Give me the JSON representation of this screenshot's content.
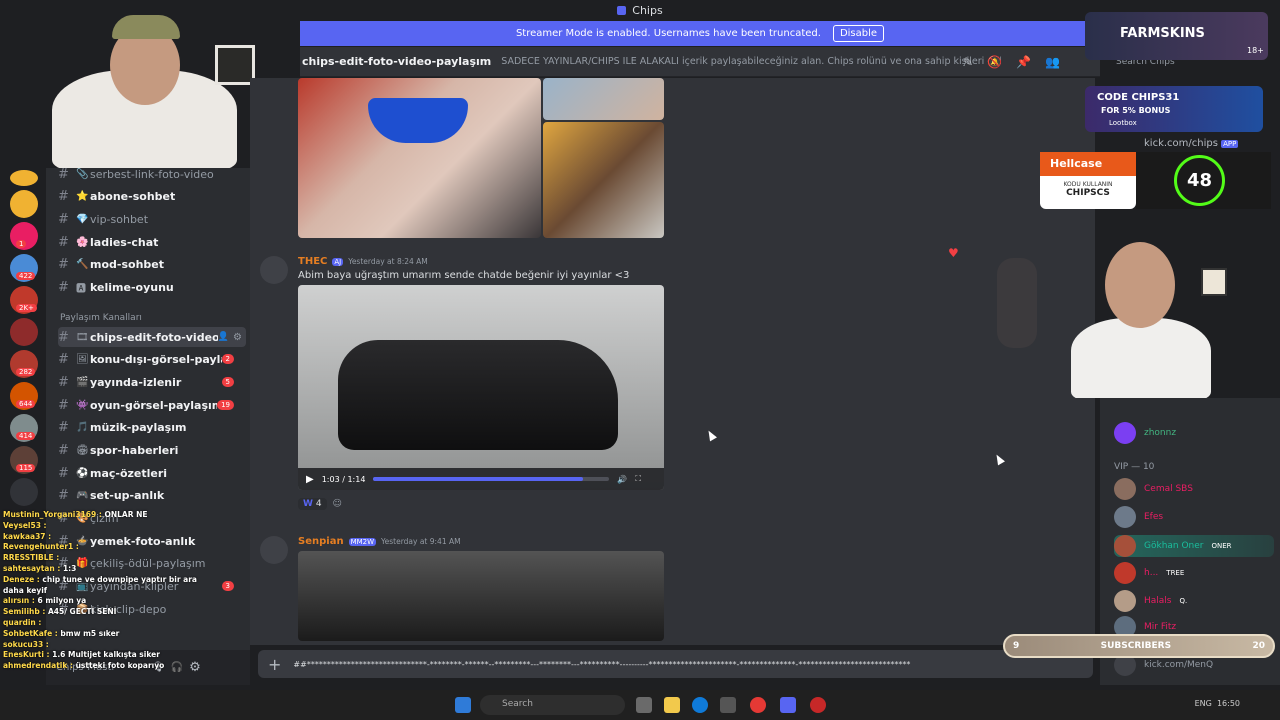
{
  "window": {
    "title": "Chips"
  },
  "banner": {
    "text": "Streamer Mode is enabled. Usernames have been truncated.",
    "button": "Disable"
  },
  "channel_header": {
    "name": "chips-edit-foto-video-paylaşım",
    "topic": "SADECE YAYINLAR/CHIPS İLE ALAKALI içerik paylaşabileceğiniz alan. Chips rolünü ve ona sahip kişileri etiketlemek yasaktır.",
    "search_placeholder": "Search Chips"
  },
  "sidebar": {
    "category": "Paylaşım Kanalları",
    "channels": [
      {
        "label": "serbest-link-foto-video",
        "emoji": "📎"
      },
      {
        "label": "abone-sohbet",
        "emoji": "⭐"
      },
      {
        "label": "vip-sohbet",
        "emoji": "💎"
      },
      {
        "label": "ladies-chat",
        "emoji": "🌸"
      },
      {
        "label": "mod-sohbet",
        "emoji": "🔨"
      },
      {
        "label": "kelime-oyunu",
        "emoji": "🅰"
      },
      {
        "label": "chips-edit-foto-video-...",
        "emoji": "🎞"
      },
      {
        "label": "konu-dışı-görsel-paylaşım",
        "emoji": "🖼",
        "count": "2"
      },
      {
        "label": "yayında-izlenir",
        "emoji": "🎬",
        "count": "5"
      },
      {
        "label": "oyun-görsel-paylaşım",
        "emoji": "👾",
        "count": "19"
      },
      {
        "label": "müzik-paylaşım",
        "emoji": "🎵"
      },
      {
        "label": "spor-haberleri",
        "emoji": "🏟"
      },
      {
        "label": "maç-özetleri",
        "emoji": "⚽"
      },
      {
        "label": "set-up-anlık",
        "emoji": "🎮"
      },
      {
        "label": "çizim",
        "emoji": "🎨"
      },
      {
        "label": "yemek-foto-anlık",
        "emoji": "🍲"
      },
      {
        "label": "çekiliş-ödül-paylaşım",
        "emoji": "🎁"
      },
      {
        "label": "yayından-klipler",
        "emoji": "📺",
        "count": "3"
      },
      {
        "label": "kick-clip-depo",
        "emoji": "📦"
      }
    ],
    "server_badges": [
      "1",
      "422",
      "2K+",
      "282",
      "644",
      "414",
      "115"
    ],
    "user": "Chips-Musti"
  },
  "messages": [
    {
      "user": "THEC",
      "tag": "AJ",
      "time": "Yesterday at 8:24 AM",
      "text": "Abim baya uğraştım umarım sende chatde beğenir iyi yayınlar <3",
      "video": {
        "time": "1:03 / 1:14",
        "progress": 0.89
      },
      "reaction": {
        "emoji": "W",
        "count": "4"
      }
    },
    {
      "user": "Senpian",
      "tag": "MM2W",
      "time": "Yesterday at 9:41 AM"
    }
  ],
  "composer": {
    "text": "##******************************-********-******--*********---********---**********----------**********************-**************-****************************"
  },
  "overlays": {
    "farmskins": "FARMSKINS",
    "farmskins_age": "18+",
    "code_title": "CODE CHIPS31",
    "code_sub": "FOR 5% BONUS",
    "code_brand": "Lootbox",
    "kick_link": "kick.com/chips",
    "kick_app": "APP",
    "hellcase": "Hellcase",
    "hellcase_sub": "KODU KULLANIN",
    "hellcase_code": "CHIPSCS",
    "timer": "48",
    "subs_left": "9",
    "subs_label": "SUBSCRIBERS",
    "subs_right": "20"
  },
  "member_list": {
    "vip_header": "VIP — 10",
    "members": [
      {
        "name": "zhonnz",
        "color": "#43b581"
      },
      {
        "name": "Cemal SBS",
        "color": "#e91e63"
      },
      {
        "name": "Efes",
        "color": "#e91e63"
      },
      {
        "name": "Gökhan Oner",
        "color": "#1abc9c",
        "badge": "ONER"
      },
      {
        "name": "h...",
        "color": "#e91e63",
        "badge": "TREE"
      },
      {
        "name": "Halals",
        "color": "#e91e63",
        "badge": "Q."
      },
      {
        "name": "Mir Fitz",
        "color": "#e91e63"
      },
      {
        "name": "kick.com/MenQ",
        "color": "#949ba4"
      }
    ]
  },
  "kick_chat": [
    [
      "Mustinin_Yorgani3169",
      "ONLAR NE"
    ],
    [
      "Veysel53",
      ""
    ],
    [
      "kawkaa37",
      ""
    ],
    [
      "Revengehunter1",
      ""
    ],
    [
      "RRESSTIBLE",
      ""
    ],
    [
      "sahtesaytan",
      "1:3"
    ],
    [
      "Deneze",
      "chip tune ve downpipe yaptır bir ara daha keyif"
    ],
    [
      "alırsın",
      "6 milyon ya"
    ],
    [
      "Semilihb",
      "A45/ GECTİ SENİ"
    ],
    [
      "quardin",
      ""
    ],
    [
      "SohbetKafe",
      "bmw m5 sıker"
    ],
    [
      "sokucu33",
      ""
    ],
    [
      "EnesKurti",
      "1.6 Multijet kalkışta siker"
    ],
    [
      "ahmedrendatik",
      "üstteki foto koparıyo"
    ]
  ],
  "taskbar": {
    "search": "Search",
    "lang": "ENG",
    "clock": "16:50"
  },
  "colors": {
    "accent": "#5865f2",
    "background": "#313338",
    "sidebar": "#2b2d31",
    "danger": "#f23f43",
    "kick_green": "#53fc18"
  }
}
